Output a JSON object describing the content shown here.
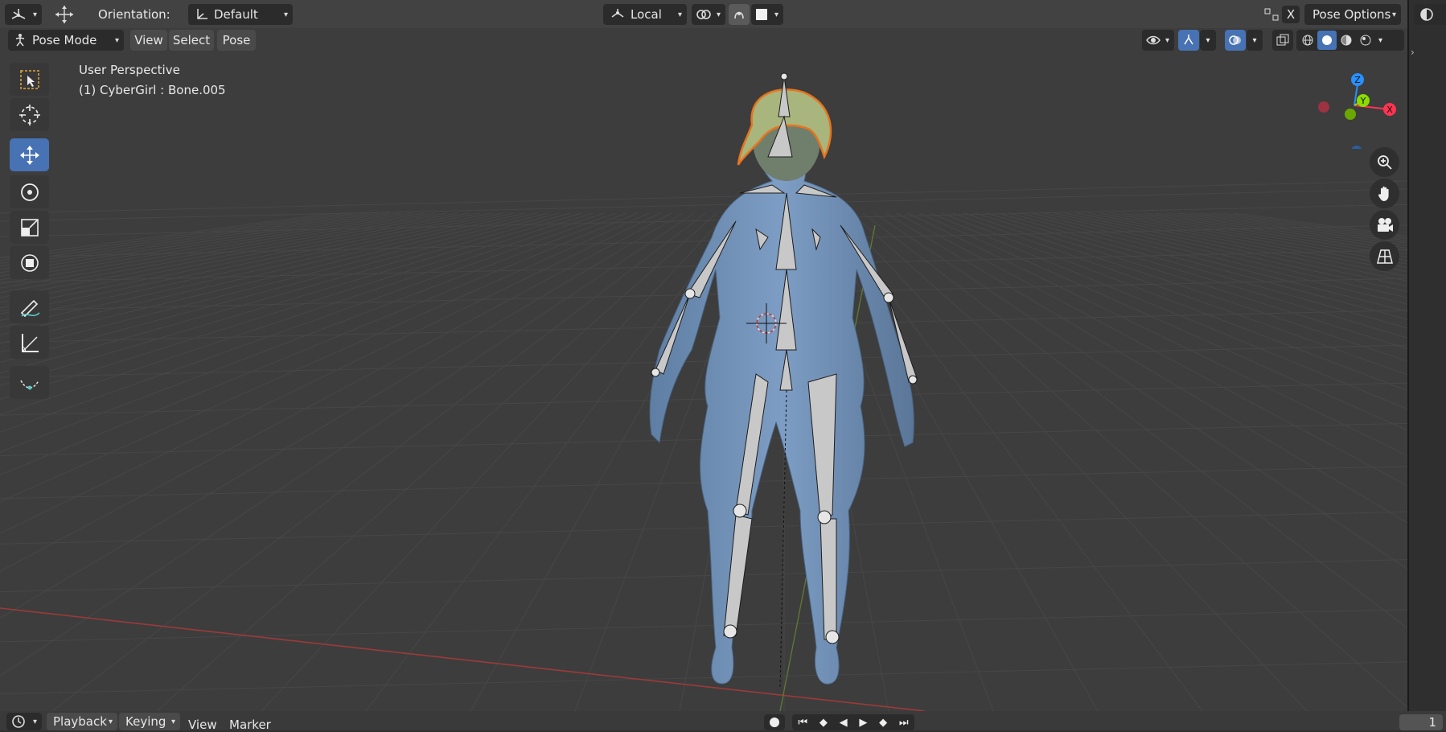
{
  "header": {
    "orientation_label": "Orientation:",
    "orientation_value": "Default",
    "pivot_value": "Local",
    "axis_x_label": "X",
    "pose_options_label": "Pose Options"
  },
  "subheader": {
    "mode_label": "Pose Mode",
    "menu_view": "View",
    "menu_select": "Select",
    "menu_pose": "Pose"
  },
  "viewport": {
    "perspective_label": "User Perspective",
    "object_info": "(1) CyberGirl : Bone.005"
  },
  "gizmo": {
    "z_label": "Z",
    "y_label": "Y",
    "x_label": "X"
  },
  "toolbar": {
    "tools": [
      "select-box",
      "cursor",
      "move",
      "rotate",
      "scale",
      "transform",
      "annotate",
      "measure",
      "bone-curve"
    ],
    "active_tool": "move"
  },
  "timeline": {
    "menu_playback": "Playback",
    "menu_keying": "Keying",
    "menu_view": "View",
    "menu_marker": "Marker",
    "current_frame": "1"
  },
  "colors": {
    "accent": "#4772b3",
    "header_bg": "#424242",
    "viewport_bg": "#3d3d3d",
    "axis_x": "#ff3352",
    "axis_y": "#8bdc00",
    "axis_z": "#2890ff"
  }
}
